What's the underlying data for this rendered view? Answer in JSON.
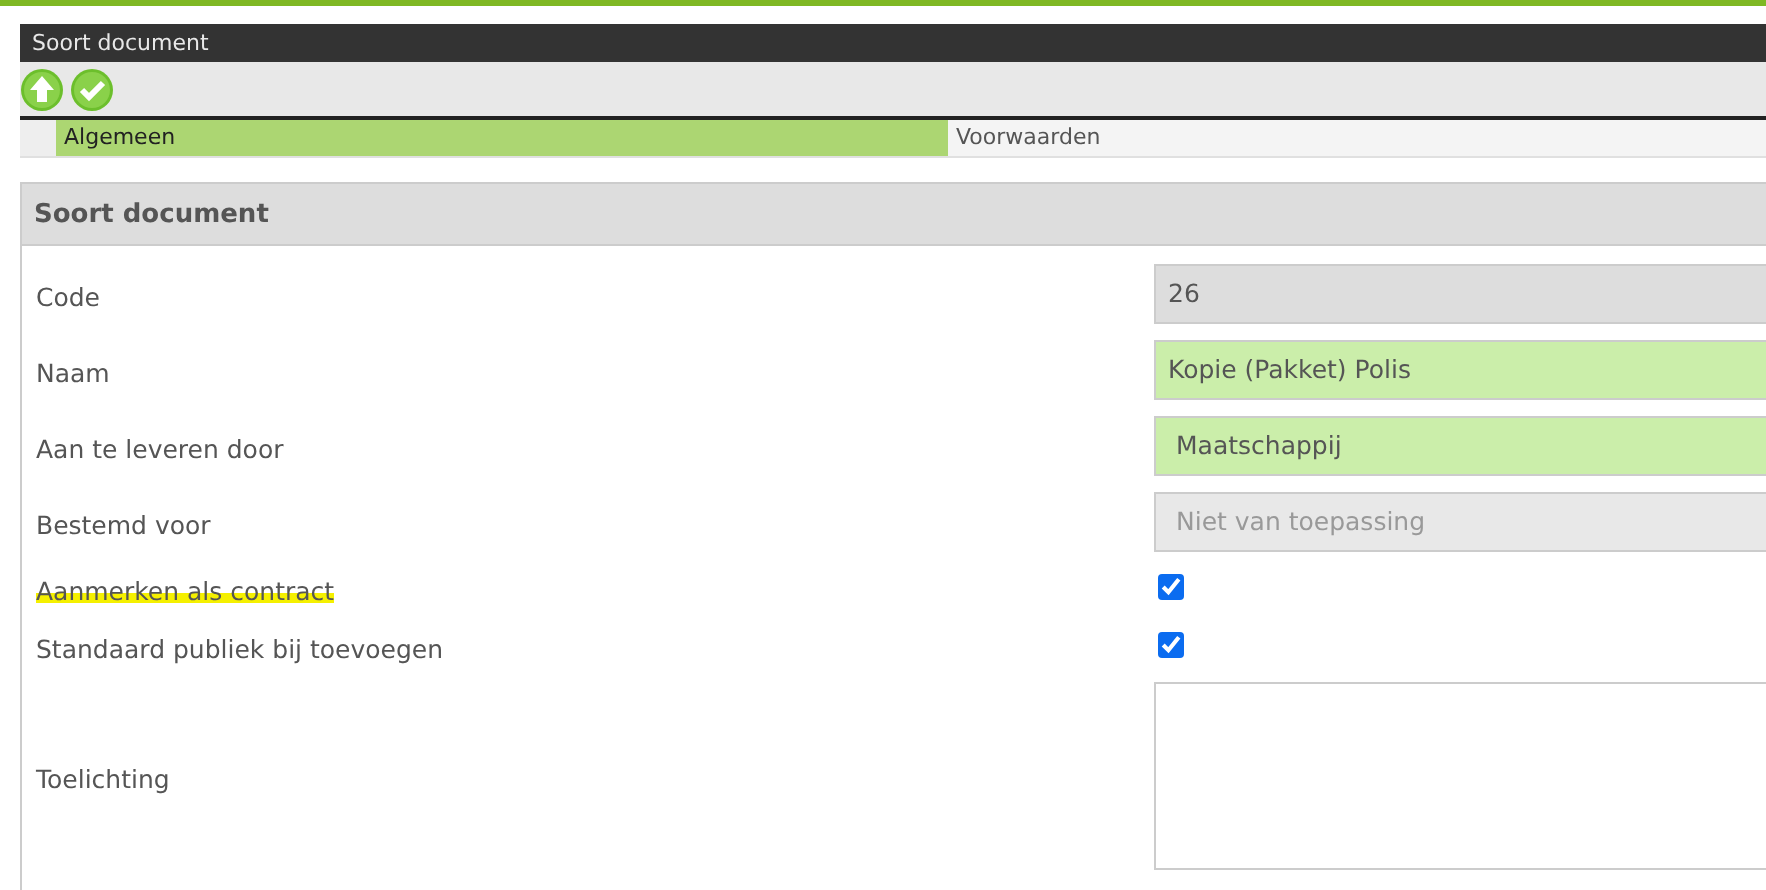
{
  "window": {
    "title": "Soort document"
  },
  "toolbar": [
    {
      "kind": "up"
    },
    {
      "kind": "confirm"
    }
  ],
  "tabs": [
    {
      "label": "Algemeen",
      "selected": true
    },
    {
      "label": "Voorwaarden",
      "selected": false
    }
  ],
  "panel": {
    "title": "Soort document",
    "fields": [
      {
        "label": "Code",
        "kind": "readonly",
        "value": "26",
        "highlighted": false
      },
      {
        "label": "Naam",
        "kind": "text",
        "value": "Kopie (Pakket) Polis",
        "highlighted": false
      },
      {
        "label": "Aan te leveren door",
        "kind": "select",
        "value": "Maatschappij",
        "highlighted": false
      },
      {
        "label": "Bestemd voor",
        "kind": "disabled",
        "value": "Niet van toepassing",
        "highlighted": false
      },
      {
        "label": "Aanmerken als contract",
        "kind": "checkbox",
        "checked": true,
        "highlighted": true
      },
      {
        "label": "Standaard publiek bij toevoegen",
        "kind": "checkbox",
        "checked": true,
        "highlighted": false
      },
      {
        "label": "Toelichting",
        "kind": "textarea",
        "highlighted": false
      }
    ]
  }
}
